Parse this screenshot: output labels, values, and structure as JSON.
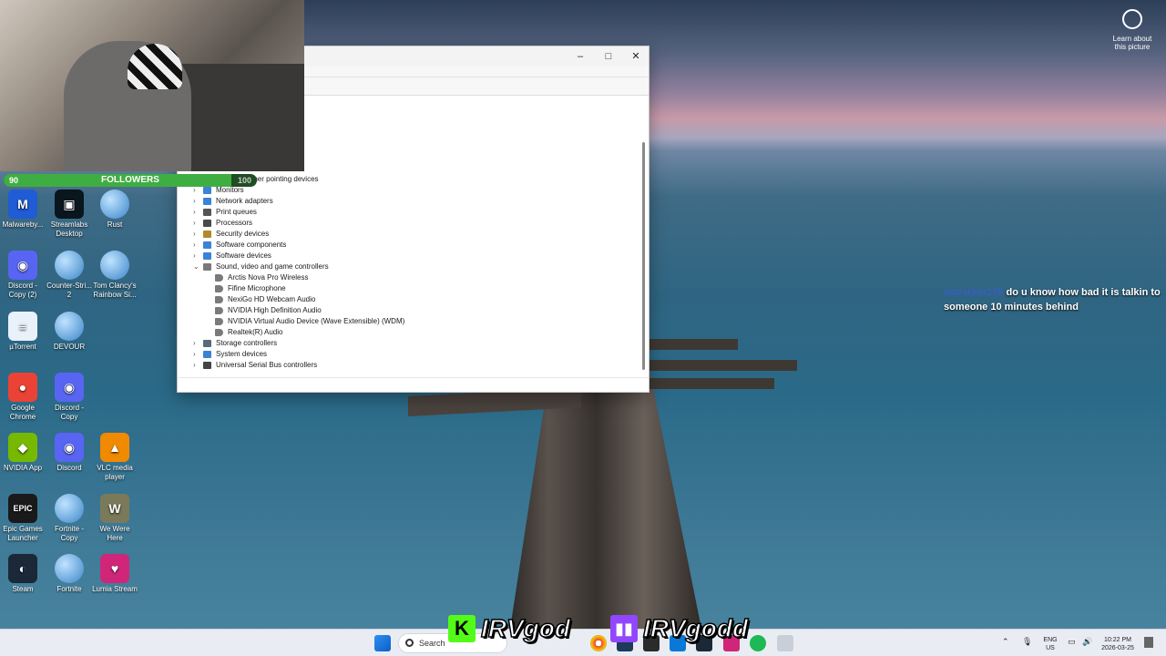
{
  "followers_goal": {
    "title": "FOLLOWERS",
    "current": "90",
    "target": "100",
    "progress": 0.9
  },
  "desktop_icons": [
    {
      "label": "Malwareby...",
      "icon": "malwarebytes-icon",
      "color": "#1f5cd6",
      "glyph": "M"
    },
    {
      "label": "Streamlabs Desktop",
      "icon": "streamlabs-icon",
      "color": "#09161d",
      "glyph": "▣"
    },
    {
      "label": "Rust",
      "icon": "shortcut-globe-icon",
      "color": "",
      "glyph": ""
    },
    {
      "label": "Discord - Copy (2)",
      "icon": "discord-icon",
      "color": "#5865f2",
      "glyph": "◉"
    },
    {
      "label": "Counter-Stri... 2",
      "icon": "shortcut-globe-icon",
      "color": "",
      "glyph": ""
    },
    {
      "label": "Tom Clancy's Rainbow Si...",
      "icon": "shortcut-globe-icon",
      "color": "",
      "glyph": ""
    },
    {
      "label": "µTorrent",
      "icon": "utorrent-icon",
      "color": "#e9f1fb",
      "glyph": "≡"
    },
    {
      "label": "DEVOUR",
      "icon": "shortcut-globe-icon",
      "color": "",
      "glyph": ""
    },
    {
      "label": "Google Chrome",
      "icon": "chrome-icon",
      "color": "#ea4335",
      "glyph": "●"
    },
    {
      "label": "Discord - Copy",
      "icon": "discord-icon",
      "color": "#5865f2",
      "glyph": "◉"
    },
    {
      "label": "NVIDIA App",
      "icon": "nvidia-icon",
      "color": "#76b900",
      "glyph": "◆"
    },
    {
      "label": "Discord",
      "icon": "discord-icon",
      "color": "#5865f2",
      "glyph": "◉"
    },
    {
      "label": "VLC media player",
      "icon": "vlc-icon",
      "color": "#f08a00",
      "glyph": "▲"
    },
    {
      "label": "Epic Games Launcher",
      "icon": "epic-games-icon",
      "color": "#1a1a1a",
      "glyph": "EPIC"
    },
    {
      "label": "Fortnite - Copy",
      "icon": "shortcut-globe-icon",
      "color": "",
      "glyph": ""
    },
    {
      "label": "We Were Here",
      "icon": "we-were-here-icon",
      "color": "#7a7a5a",
      "glyph": "W"
    },
    {
      "label": "Steam",
      "icon": "steam-icon",
      "color": "#1b2838",
      "glyph": "◐"
    },
    {
      "label": "Fortnite",
      "icon": "shortcut-globe-icon",
      "color": "",
      "glyph": ""
    },
    {
      "label": "Lumia Stream",
      "icon": "lumia-stream-icon",
      "color": "#d0267a",
      "glyph": "♥"
    }
  ],
  "device_manager": {
    "window_controls": {
      "minimize": "–",
      "maximize": "□",
      "close": "✕"
    },
    "tree": [
      {
        "label": "Mice and other pointing devices",
        "expanded": false,
        "icon": "mouse-icon",
        "color": "#6a7c8e"
      },
      {
        "label": "Monitors",
        "expanded": false,
        "icon": "monitor-icon",
        "color": "#3b83d6"
      },
      {
        "label": "Network adapters",
        "expanded": false,
        "icon": "network-adapter-icon",
        "color": "#3b83d6"
      },
      {
        "label": "Print queues",
        "expanded": false,
        "icon": "printer-icon",
        "color": "#555555"
      },
      {
        "label": "Processors",
        "expanded": false,
        "icon": "processor-icon",
        "color": "#4a4a4a"
      },
      {
        "label": "Security devices",
        "expanded": false,
        "icon": "security-device-icon",
        "color": "#b08a2a"
      },
      {
        "label": "Software components",
        "expanded": false,
        "icon": "software-component-icon",
        "color": "#3b83d6"
      },
      {
        "label": "Software devices",
        "expanded": false,
        "icon": "software-device-icon",
        "color": "#3b83d6"
      },
      {
        "label": "Sound, video and game controllers",
        "expanded": true,
        "icon": "speaker-icon",
        "color": "#7a7a7a"
      },
      {
        "label": "Arctis Nova Pro Wireless",
        "child": true,
        "icon": "speaker-icon",
        "color": "#7a7a7a"
      },
      {
        "label": "Fifine Microphone",
        "child": true,
        "icon": "speaker-icon",
        "color": "#7a7a7a"
      },
      {
        "label": "NexiGo HD Webcam Audio",
        "child": true,
        "icon": "speaker-icon",
        "color": "#7a7a7a"
      },
      {
        "label": "NVIDIA High Definition Audio",
        "child": true,
        "icon": "speaker-icon",
        "color": "#7a7a7a"
      },
      {
        "label": "NVIDIA Virtual Audio Device (Wave Extensible) (WDM)",
        "child": true,
        "icon": "speaker-icon",
        "color": "#7a7a7a"
      },
      {
        "label": "Realtek(R) Audio",
        "child": true,
        "icon": "speaker-icon",
        "color": "#7a7a7a"
      },
      {
        "label": "Storage controllers",
        "expanded": false,
        "icon": "storage-controller-icon",
        "color": "#5a6a7a"
      },
      {
        "label": "System devices",
        "expanded": false,
        "icon": "system-device-icon",
        "color": "#3b83d6"
      },
      {
        "label": "Universal Serial Bus controllers",
        "expanded": false,
        "icon": "usb-icon",
        "color": "#444444"
      }
    ]
  },
  "learn_about": {
    "label": "Learn about this picture"
  },
  "chat": {
    "username": "wxtracker235",
    "message": "do u know how bad it is talkin to someone 10 minutes behind"
  },
  "stream_overlay": {
    "kick_name": "IRVgod",
    "twitch_name": "IRVgodd",
    "kick_logo": "K",
    "twitch_logo": "▮▮"
  },
  "taskbar": {
    "search_placeholder": "Search",
    "language": "ENG",
    "region": "US",
    "time": "10:22 PM",
    "date": "2026-03-25"
  }
}
